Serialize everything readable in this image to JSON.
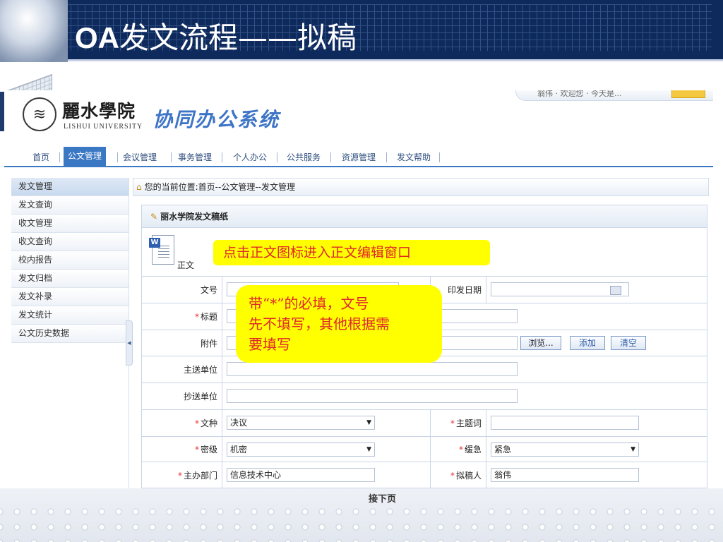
{
  "slide": {
    "title_oa": "OA",
    "title_rest": "发文流程——拟稿"
  },
  "oa": {
    "logo": {
      "seal_glyph": "≋",
      "university_cn": "麗水學院",
      "university_en": "LISHUI UNIVERSITY",
      "system_name": "协同办公系统"
    },
    "topright": {
      "text": "翁伟 · 欢迎您 · 今天是..."
    },
    "nav": {
      "items": [
        "首页",
        "公文管理",
        "会议管理",
        "事务管理",
        "个人办公",
        "公共服务",
        "资源管理",
        "发文帮助"
      ],
      "active": "公文管理"
    },
    "sidebar": {
      "items": [
        "发文管理",
        "发文查询",
        "收文管理",
        "收文查询",
        "校内报告",
        "发文归档",
        "发文补录",
        "发文统计",
        "公文历史数据"
      ],
      "active": "发文管理"
    },
    "breadcrumb": "您的当前位置:首页--公文管理--发文管理",
    "panel": {
      "title": "丽水学院发文稿纸",
      "zhengwen_label": "正文",
      "word_glyph": "W"
    },
    "form": {
      "wenhao_label": "文号",
      "wenhao_value": "",
      "yinfa_label": "印发日期",
      "yinfa_value": "",
      "biaoti_label": "标题",
      "biaoti_value": "",
      "fujian_label": "附件",
      "fujian_value": "",
      "browse_btn": "浏览...",
      "add_btn": "添加",
      "clear_btn": "清空",
      "zhusong_label": "主送单位",
      "zhusong_value": "",
      "chaosong_label": "抄送单位",
      "chaosong_value": "",
      "wenzhong_label": "文种",
      "wenzhong_value": "决议",
      "zhutici_label": "主题词",
      "zhutici_value": "",
      "miji_label": "密级",
      "miji_value": "机密",
      "huanji_label": "缓急",
      "huanji_value": "紧急",
      "zhuban_label": "主办部门",
      "zhuban_value": "信息技术中心",
      "nigao_label": "拟稿人",
      "nigao_value": "翁伟",
      "required_mark": "*"
    }
  },
  "callouts": {
    "click_icon": "点击正文图标进入正文编辑窗口",
    "required_note_line1": "带“*”的必填，文号",
    "required_note_line2": "先不填写，其他根据需",
    "required_note_line3": "要填写"
  },
  "footer": {
    "next_page": "接下页"
  },
  "colors": {
    "header_bg": "#0e2a5c",
    "nav_accent": "#3a78c4",
    "callout_bg": "#ffff00",
    "callout_text": "#e0262a",
    "required": "#e33333"
  }
}
